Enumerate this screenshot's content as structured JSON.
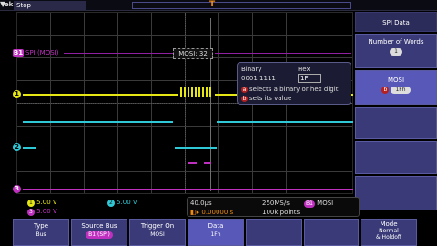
{
  "topbar": {
    "brand": "Tek",
    "status": "Stop",
    "trigger_marker": "T"
  },
  "bus": {
    "label": "SPI (MOSI)",
    "decoded_value": "MOSI: 32"
  },
  "popup": {
    "binary_header": "Binary",
    "hex_header": "Hex",
    "binary_value": "0001 1111",
    "hex_value": "1F",
    "hint1_badge": "a",
    "hint1": "selects a binary or hex digit",
    "hint2_badge": "b",
    "hint2": "sets its value"
  },
  "side_menu": {
    "title": "SPI Data",
    "words_label": "Number of Words",
    "words_value": "1",
    "mosi_label": "MOSI",
    "mosi_badge": "b",
    "mosi_value": "1Fh"
  },
  "readouts": {
    "ch1_badge": "1",
    "ch1_scale": "5.00 V",
    "ch2_badge": "2",
    "ch2_scale": "5.00 V",
    "ch3_badge": "3",
    "ch3_scale": "5.00 V",
    "timebase": "40.0µs",
    "sample_rate": "250MS/s",
    "trigger_source_badge": "B1",
    "trigger_source": "MOSI",
    "delay": "0.00000 s",
    "points": "100k points"
  },
  "bottom_menu": {
    "type_label": "Type",
    "type_value": "Bus",
    "source_label": "Source Bus",
    "source_value": "B1 (SPI)",
    "trigger_on_label": "Trigger On",
    "trigger_on_value": "MOSI",
    "data_label": "Data",
    "data_value": "1Fh",
    "mode_label": "Mode",
    "mode_value1": "Normal",
    "mode_value2": "& Holdoff"
  },
  "colors": {
    "ch1": "#e6e615",
    "ch2": "#2ec8d6",
    "bus": "#c030c0",
    "trigger": "#f08a10",
    "menu": "#3a3a78"
  }
}
